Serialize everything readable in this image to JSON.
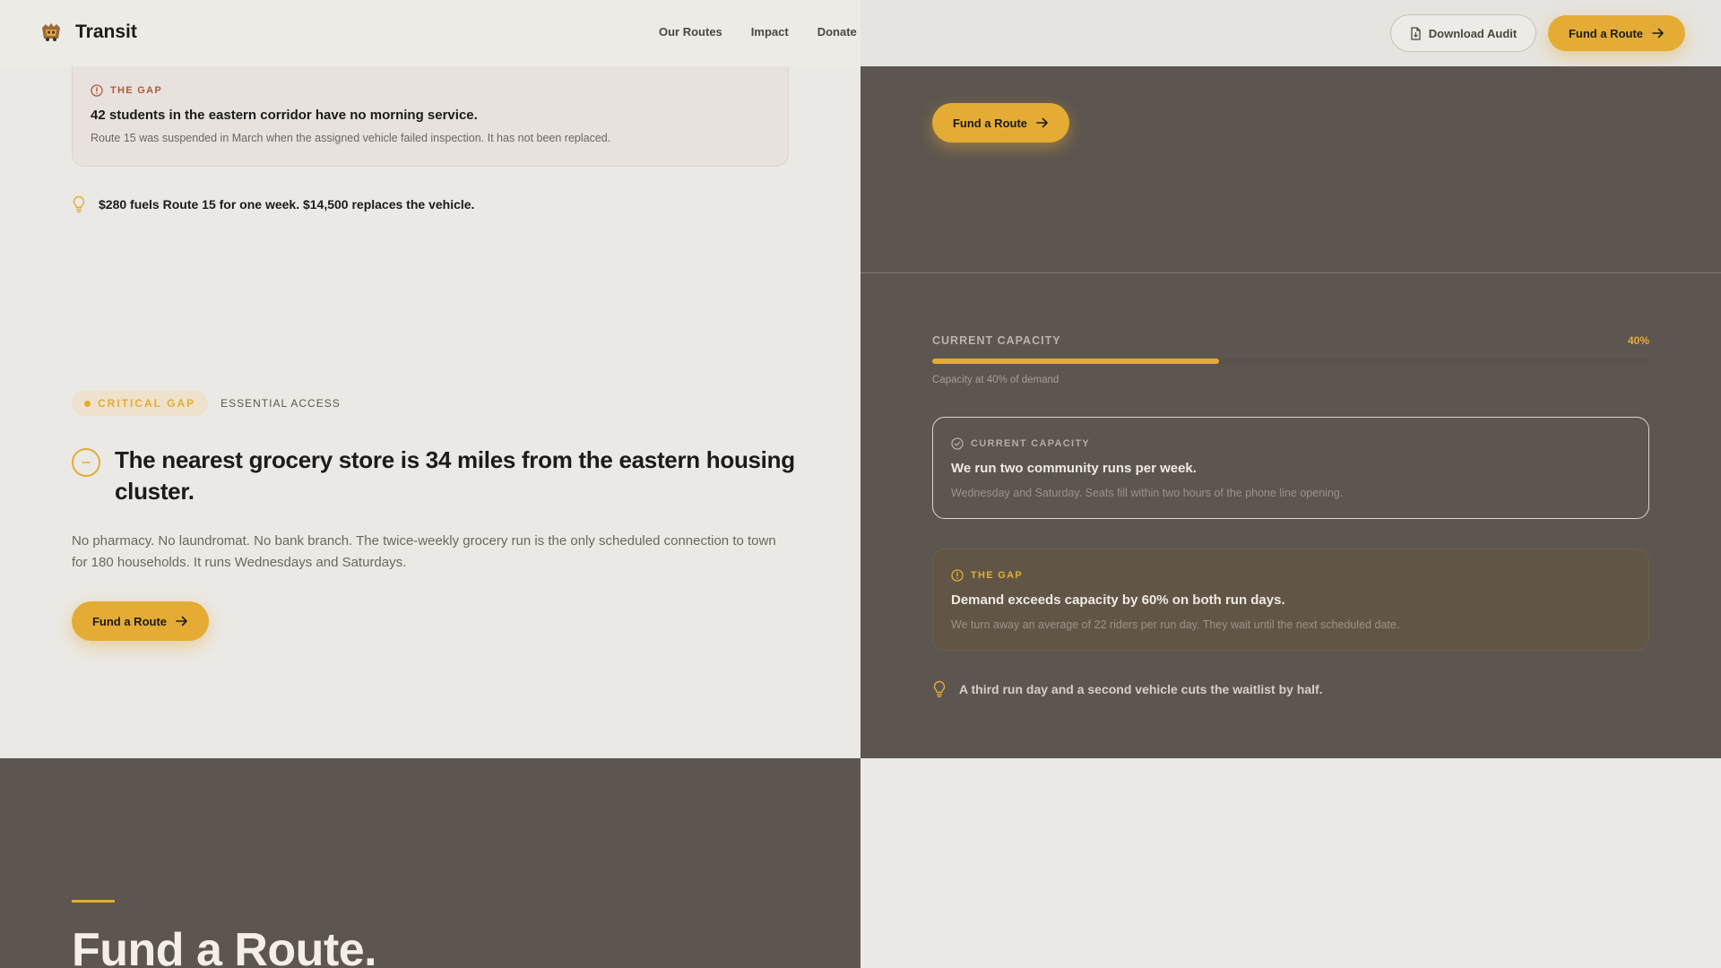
{
  "header": {
    "logo_text": "Transit",
    "nav": [
      "Our Routes",
      "Impact",
      "Donate"
    ],
    "download_label": "Download Audit",
    "fund_label": "Fund a Route"
  },
  "left": {
    "gap_card": {
      "label": "THE GAP",
      "title": "42 students in the eastern corridor have no morning service.",
      "desc": "Route 15 was suspended in March when the assigned vehicle failed inspection. It has not been replaced."
    },
    "tip": "$280 fuels Route 15 for one week. $14,500 replaces the vehicle.",
    "badge_critical": "CRITICAL GAP",
    "badge_category": "ESSENTIAL ACCESS",
    "headline": "The nearest grocery store is 34 miles from the eastern housing cluster.",
    "body": "No pharmacy. No laundromat. No bank branch. The twice-weekly grocery run is the only scheduled connection to town for 180 households. It runs Wednesdays and Saturdays.",
    "cta": "Fund a Route"
  },
  "right": {
    "cta": "Fund a Route",
    "capacity": {
      "label": "CURRENT CAPACITY",
      "percent_text": "40%",
      "fraction": 0.4,
      "note": "Capacity at 40% of demand"
    },
    "card_capacity": {
      "label": "CURRENT CAPACITY",
      "title": "We run two community runs per week.",
      "desc": "Wednesday and Saturday. Seats fill within two hours of the phone line opening."
    },
    "card_gap": {
      "label": "THE GAP",
      "title": "Demand exceeds capacity by 60% on both run days.",
      "desc": "We turn away an average of 22 riders per run day. They wait until the next scheduled date."
    },
    "tip": "A third run day and a second vehicle cuts the waitlist by half."
  },
  "bottom": {
    "title": "Fund a Route."
  },
  "colors": {
    "accent": "#e4ac35",
    "dark_panel": "#5c5550",
    "light_bg": "#ebe9e5",
    "gap_label": "#b05a3a"
  },
  "icons": {
    "logo": "bus-crest-icon",
    "download": "document-icon",
    "arrow": "arrow-right-icon",
    "gap": "alert-circle-icon",
    "capacity": "check-circle-icon",
    "tip": "lightbulb-icon",
    "critical": "minus-circle-icon"
  }
}
